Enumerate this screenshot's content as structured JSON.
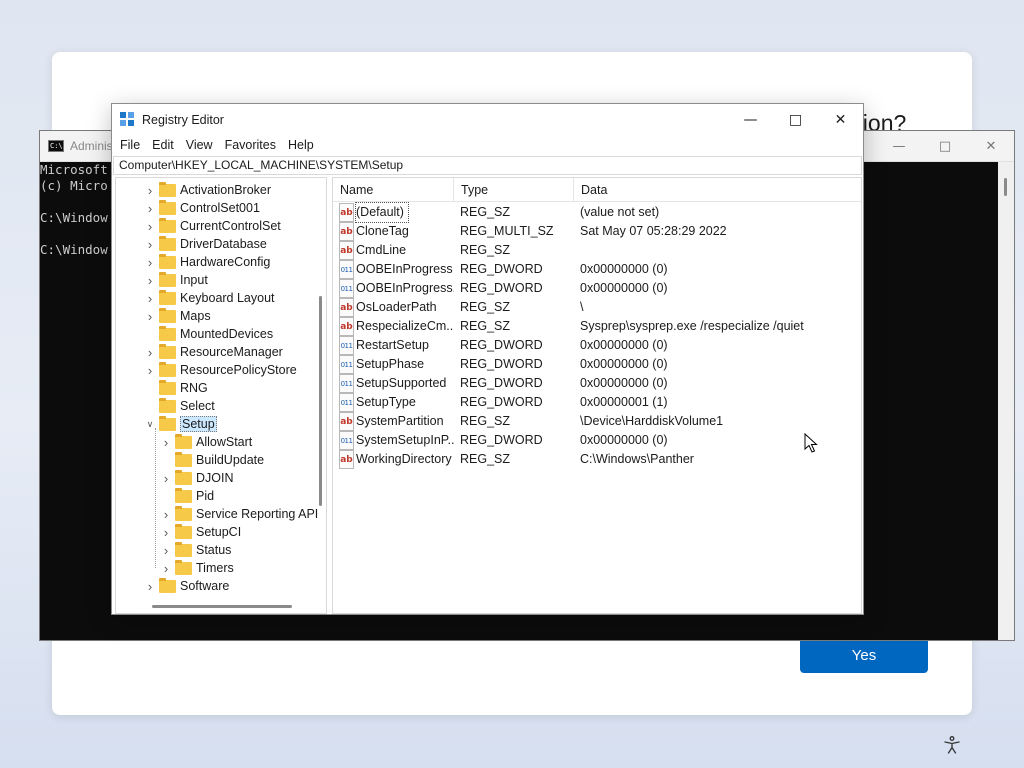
{
  "oobe": {
    "question_fragment": "gion?",
    "yes_label": "Yes"
  },
  "cmd": {
    "title": "Adminis",
    "lines": [
      "Microsoft",
      "(c) Micro",
      "",
      "C:\\Window",
      "",
      "C:\\Window"
    ]
  },
  "regedit": {
    "title": "Registry Editor",
    "menu": [
      "File",
      "Edit",
      "View",
      "Favorites",
      "Help"
    ],
    "address": "Computer\\HKEY_LOCAL_MACHINE\\SYSTEM\\Setup",
    "tree": [
      {
        "label": "ActivationBroker",
        "expandable": true
      },
      {
        "label": "ControlSet001",
        "expandable": true
      },
      {
        "label": "CurrentControlSet",
        "expandable": true
      },
      {
        "label": "DriverDatabase",
        "expandable": true
      },
      {
        "label": "HardwareConfig",
        "expandable": true
      },
      {
        "label": "Input",
        "expandable": true
      },
      {
        "label": "Keyboard Layout",
        "expandable": true
      },
      {
        "label": "Maps",
        "expandable": true
      },
      {
        "label": "MountedDevices",
        "expandable": false
      },
      {
        "label": "ResourceManager",
        "expandable": true
      },
      {
        "label": "ResourcePolicyStore",
        "expandable": true
      },
      {
        "label": "RNG",
        "expandable": false
      },
      {
        "label": "Select",
        "expandable": false
      },
      {
        "label": "Setup",
        "expandable": true,
        "expanded": true,
        "selected": true
      },
      {
        "label": "AllowStart",
        "expandable": true,
        "child": true
      },
      {
        "label": "BuildUpdate",
        "expandable": false,
        "child": true
      },
      {
        "label": "DJOIN",
        "expandable": true,
        "child": true
      },
      {
        "label": "Pid",
        "expandable": false,
        "child": true
      },
      {
        "label": "Service Reporting API",
        "expandable": true,
        "child": true
      },
      {
        "label": "SetupCI",
        "expandable": true,
        "child": true
      },
      {
        "label": "Status",
        "expandable": true,
        "child": true
      },
      {
        "label": "Timers",
        "expandable": true,
        "child": true
      },
      {
        "label": "Software",
        "expandable": true
      }
    ],
    "columns": {
      "name": "Name",
      "type": "Type",
      "data": "Data"
    },
    "values": [
      {
        "icon": "sz",
        "name": "(Default)",
        "type": "REG_SZ",
        "data": "(value not set)",
        "focused": true
      },
      {
        "icon": "sz",
        "name": "CloneTag",
        "type": "REG_MULTI_SZ",
        "data": "Sat May 07 05:28:29 2022"
      },
      {
        "icon": "sz",
        "name": "CmdLine",
        "type": "REG_SZ",
        "data": ""
      },
      {
        "icon": "dw",
        "name": "OOBEInProgress",
        "type": "REG_DWORD",
        "data": "0x00000000 (0)"
      },
      {
        "icon": "dw",
        "name": "OOBEInProgress...",
        "type": "REG_DWORD",
        "data": "0x00000000 (0)"
      },
      {
        "icon": "sz",
        "name": "OsLoaderPath",
        "type": "REG_SZ",
        "data": "\\"
      },
      {
        "icon": "sz",
        "name": "RespecializeCm...",
        "type": "REG_SZ",
        "data": "Sysprep\\sysprep.exe /respecialize /quiet"
      },
      {
        "icon": "dw",
        "name": "RestartSetup",
        "type": "REG_DWORD",
        "data": "0x00000000 (0)"
      },
      {
        "icon": "dw",
        "name": "SetupPhase",
        "type": "REG_DWORD",
        "data": "0x00000000 (0)"
      },
      {
        "icon": "dw",
        "name": "SetupSupported",
        "type": "REG_DWORD",
        "data": "0x00000000 (0)"
      },
      {
        "icon": "dw",
        "name": "SetupType",
        "type": "REG_DWORD",
        "data": "0x00000001 (1)"
      },
      {
        "icon": "sz",
        "name": "SystemPartition",
        "type": "REG_SZ",
        "data": "\\Device\\HarddiskVolume1"
      },
      {
        "icon": "dw",
        "name": "SystemSetupInP...",
        "type": "REG_DWORD",
        "data": "0x00000000 (0)"
      },
      {
        "icon": "sz",
        "name": "WorkingDirectory",
        "type": "REG_SZ",
        "data": "C:\\Windows\\Panther"
      }
    ],
    "icon_text": {
      "sz": "ab",
      "dw": "011"
    }
  },
  "colors": {
    "accent": "#0067c0",
    "selection": "#cce8ff",
    "folder": "#f7c948"
  }
}
